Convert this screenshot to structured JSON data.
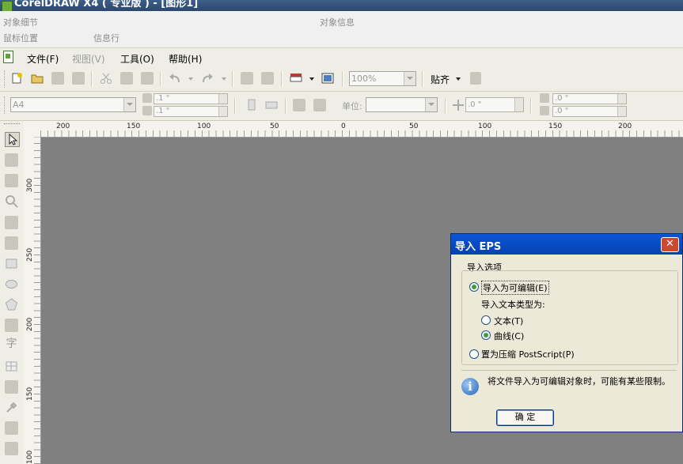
{
  "window": {
    "title": "CorelDRAW X4 ( 专业版 ) - [图形1]"
  },
  "info_bar": {
    "object_details": "对象细节",
    "object_info": "对象信息",
    "mouse_position": "鼠标位置",
    "info_line": "信息行"
  },
  "menu": {
    "file": "文件(F)",
    "view": "视图(V)",
    "tools": "工具(O)",
    "help": "帮助(H)"
  },
  "toolbar": {
    "zoom_value": "100%",
    "snap_label": "贴齐"
  },
  "property_bar": {
    "paper_size": "A4",
    "width": ".1 \"",
    "height": ".1 \"",
    "units_label": "单位:",
    "nudge": ".0 \"",
    "dup_x": ".0 \"",
    "dup_y": ".0 \""
  },
  "rulers": {
    "horizontal_ticks": [
      "200",
      "150",
      "100",
      "50",
      "0",
      "50",
      "100",
      "150",
      "200"
    ],
    "vertical_ticks": [
      "300",
      "250",
      "200",
      "150",
      "100"
    ]
  },
  "toolbox": {
    "text_tool_glyph": "字"
  },
  "dialog": {
    "title": "导入 EPS",
    "close_glyph": "✕",
    "group_title": "导入选项",
    "option_editable": "导入为可编辑(E)",
    "text_type_label": "导入文本类型为:",
    "text_type_text": "文本(T)",
    "text_type_curves": "曲线(C)",
    "option_postscript": "置为压缩 PostScript(P)",
    "info_message": "将文件导入为可编辑对象时，可能有某些限制。",
    "ok_label": "确 定"
  },
  "colors": {
    "title_bar": "#2b476c",
    "canvas": "#808080",
    "dialog_title": "#0a55d6"
  }
}
